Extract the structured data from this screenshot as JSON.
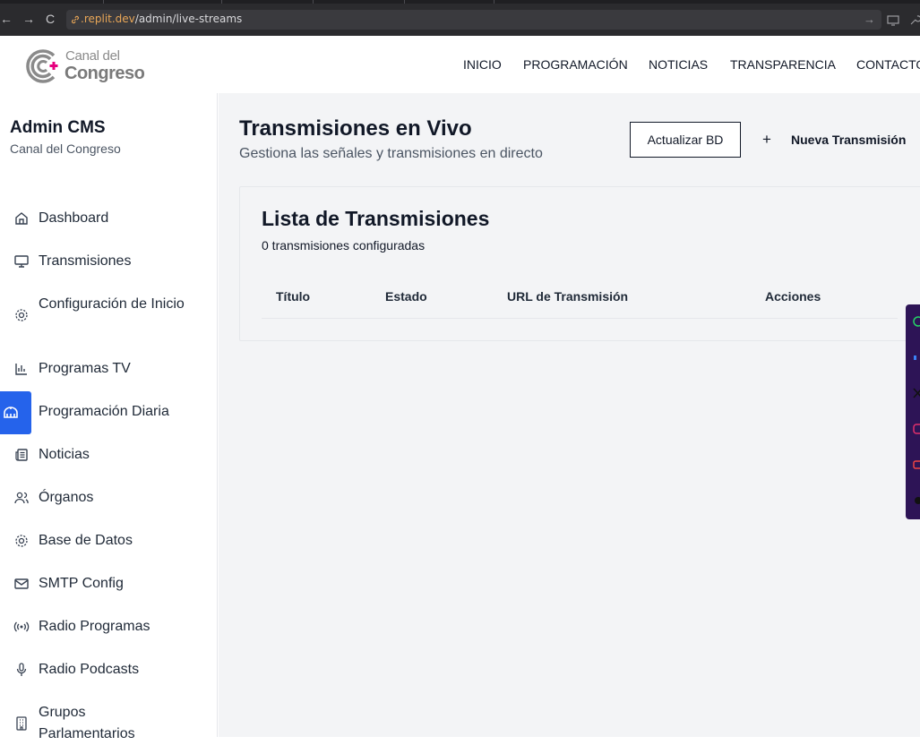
{
  "browser": {
    "url_host": ".replit.dev",
    "url_path": "/admin/live-streams"
  },
  "site": {
    "logo_small": "Canal del",
    "logo_big": "Congreso",
    "nav": [
      "INICIO",
      "PROGRAMACIÓN",
      "NOTICIAS",
      "TRANSPARENCIA",
      "CONTACTO"
    ]
  },
  "sidebar": {
    "title": "Admin CMS",
    "subtitle": "Canal del Congreso",
    "items": [
      {
        "label": "Dashboard",
        "icon": "home-icon"
      },
      {
        "label": "Transmisiones",
        "icon": "monitor-icon"
      },
      {
        "label": "Configuración de Inicio",
        "icon": "settings-gear-icon"
      },
      {
        "label": "Programas TV",
        "icon": "bar-chart-icon"
      },
      {
        "label": "Programación Diaria",
        "icon": "calendar-icon"
      },
      {
        "label": "Noticias",
        "icon": "newspaper-icon"
      },
      {
        "label": "Órganos",
        "icon": "users-icon"
      },
      {
        "label": "Base de Datos",
        "icon": "settings-gear-icon"
      },
      {
        "label": "SMTP Config",
        "icon": "mail-icon"
      },
      {
        "label": "Radio Programas",
        "icon": "radio-waves-icon"
      },
      {
        "label": "Radio Podcasts",
        "icon": "microphone-icon"
      },
      {
        "label": "Grupos Parlamentarios",
        "icon": "building-icon"
      }
    ]
  },
  "main": {
    "title": "Transmisiones en Vivo",
    "subtitle": "Gestiona las señales y transmisiones en directo",
    "refresh_button": "Actualizar BD",
    "new_button": "Nueva Transmisión",
    "new_button_icon": "plus-icon"
  },
  "list": {
    "title": "Lista de Transmisiones",
    "count_text": "0 transmisiones configuradas",
    "columns": [
      "Título",
      "Estado",
      "URL de Transmisión",
      "Acciones"
    ],
    "rows": []
  },
  "social_bar": {
    "icons": [
      "whatsapp-icon",
      "facebook-icon",
      "x-icon",
      "instagram-icon",
      "youtube-icon",
      "threads-icon"
    ]
  },
  "colors": {
    "accent": "#2563eb",
    "logo_plus": "#e6007e",
    "social_bg": "#2d1456"
  }
}
